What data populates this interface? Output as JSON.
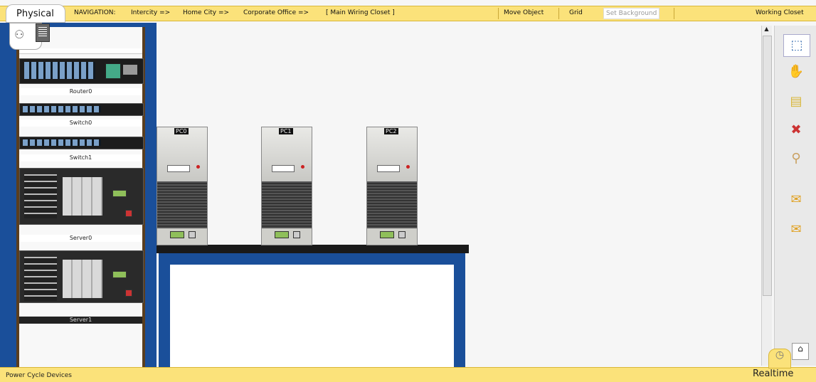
{
  "topbar": {
    "tab_physical": "Physical",
    "navigation_label": "NAVIGATION:",
    "crumbs": [
      "Intercity =>",
      "Home City =>",
      "Corporate Office =>",
      "[ Main Wiring Closet ]"
    ],
    "move_object": "Move Object",
    "grid": "Grid",
    "set_background": "Set Background",
    "location": "Working Closet"
  },
  "rack": {
    "devices": [
      "Router0",
      "Switch0",
      "Switch1",
      "Server0",
      "Server1"
    ]
  },
  "workspace": {
    "pcs": [
      "PC0",
      "PC1",
      "PC2"
    ]
  },
  "toolbar": {
    "icons": [
      "select-icon",
      "hand-icon",
      "note-icon",
      "delete-icon",
      "zoom-icon",
      "add-simple-pdu-icon",
      "add-complex-pdu-icon"
    ]
  },
  "bottombar": {
    "power_cycle": "Power Cycle Devices",
    "realtime": "Realtime"
  }
}
